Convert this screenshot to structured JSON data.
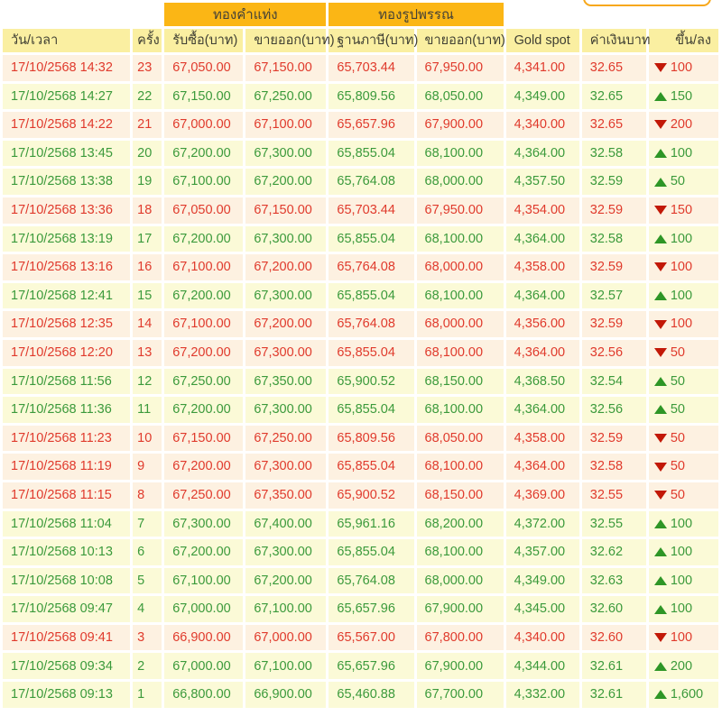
{
  "colors": {
    "page_bg": "#FFFFFF",
    "banner_bg": "#FBB615",
    "banner_text": "#454237",
    "header_bg": "#FAEFA1",
    "header_text": "#3F3F33",
    "up_bg": "#FBFAD7",
    "up_text": "#3B9A3B",
    "down_bg": "#FDF1E1",
    "down_text": "#E03A2C",
    "up_arrow": "#2E9626",
    "down_arrow": "#C21807",
    "button_border": "#F7A81C"
  },
  "table": {
    "group_headers": [
      {
        "label": "ทองคำแท่ง"
      },
      {
        "label": "ทองรูปพรรณ"
      }
    ],
    "columns": [
      "วัน/เวลา",
      "ครั้ง",
      "รับซื้อ(บาท)",
      "ขายออก(บาท)",
      "ฐานภาษี(บาท)",
      "ขายออก(บาท)",
      "Gold spot",
      "ค่าเงินบาท",
      "ขึ้น/ลง"
    ],
    "rows": [
      {
        "datetime": "17/10/2568 14:32",
        "count": "23",
        "bar_buy": "67,050.00",
        "bar_sell": "67,150.00",
        "tax_base": "65,703.44",
        "ornament_sell": "67,950.00",
        "gold_spot": "4,341.00",
        "baht_rate": "32.65",
        "direction": "down",
        "change": "100"
      },
      {
        "datetime": "17/10/2568 14:27",
        "count": "22",
        "bar_buy": "67,150.00",
        "bar_sell": "67,250.00",
        "tax_base": "65,809.56",
        "ornament_sell": "68,050.00",
        "gold_spot": "4,349.00",
        "baht_rate": "32.65",
        "direction": "up",
        "change": "150"
      },
      {
        "datetime": "17/10/2568 14:22",
        "count": "21",
        "bar_buy": "67,000.00",
        "bar_sell": "67,100.00",
        "tax_base": "65,657.96",
        "ornament_sell": "67,900.00",
        "gold_spot": "4,340.00",
        "baht_rate": "32.65",
        "direction": "down",
        "change": "200"
      },
      {
        "datetime": "17/10/2568 13:45",
        "count": "20",
        "bar_buy": "67,200.00",
        "bar_sell": "67,300.00",
        "tax_base": "65,855.04",
        "ornament_sell": "68,100.00",
        "gold_spot": "4,364.00",
        "baht_rate": "32.58",
        "direction": "up",
        "change": "100"
      },
      {
        "datetime": "17/10/2568 13:38",
        "count": "19",
        "bar_buy": "67,100.00",
        "bar_sell": "67,200.00",
        "tax_base": "65,764.08",
        "ornament_sell": "68,000.00",
        "gold_spot": "4,357.50",
        "baht_rate": "32.59",
        "direction": "up",
        "change": "50"
      },
      {
        "datetime": "17/10/2568 13:36",
        "count": "18",
        "bar_buy": "67,050.00",
        "bar_sell": "67,150.00",
        "tax_base": "65,703.44",
        "ornament_sell": "67,950.00",
        "gold_spot": "4,354.00",
        "baht_rate": "32.59",
        "direction": "down",
        "change": "150"
      },
      {
        "datetime": "17/10/2568 13:19",
        "count": "17",
        "bar_buy": "67,200.00",
        "bar_sell": "67,300.00",
        "tax_base": "65,855.04",
        "ornament_sell": "68,100.00",
        "gold_spot": "4,364.00",
        "baht_rate": "32.58",
        "direction": "up",
        "change": "100"
      },
      {
        "datetime": "17/10/2568 13:16",
        "count": "16",
        "bar_buy": "67,100.00",
        "bar_sell": "67,200.00",
        "tax_base": "65,764.08",
        "ornament_sell": "68,000.00",
        "gold_spot": "4,358.00",
        "baht_rate": "32.59",
        "direction": "down",
        "change": "100"
      },
      {
        "datetime": "17/10/2568 12:41",
        "count": "15",
        "bar_buy": "67,200.00",
        "bar_sell": "67,300.00",
        "tax_base": "65,855.04",
        "ornament_sell": "68,100.00",
        "gold_spot": "4,364.00",
        "baht_rate": "32.57",
        "direction": "up",
        "change": "100"
      },
      {
        "datetime": "17/10/2568 12:35",
        "count": "14",
        "bar_buy": "67,100.00",
        "bar_sell": "67,200.00",
        "tax_base": "65,764.08",
        "ornament_sell": "68,000.00",
        "gold_spot": "4,356.00",
        "baht_rate": "32.59",
        "direction": "down",
        "change": "100"
      },
      {
        "datetime": "17/10/2568 12:20",
        "count": "13",
        "bar_buy": "67,200.00",
        "bar_sell": "67,300.00",
        "tax_base": "65,855.04",
        "ornament_sell": "68,100.00",
        "gold_spot": "4,364.00",
        "baht_rate": "32.56",
        "direction": "down",
        "change": "50"
      },
      {
        "datetime": "17/10/2568 11:56",
        "count": "12",
        "bar_buy": "67,250.00",
        "bar_sell": "67,350.00",
        "tax_base": "65,900.52",
        "ornament_sell": "68,150.00",
        "gold_spot": "4,368.50",
        "baht_rate": "32.54",
        "direction": "up",
        "change": "50"
      },
      {
        "datetime": "17/10/2568 11:36",
        "count": "11",
        "bar_buy": "67,200.00",
        "bar_sell": "67,300.00",
        "tax_base": "65,855.04",
        "ornament_sell": "68,100.00",
        "gold_spot": "4,364.00",
        "baht_rate": "32.56",
        "direction": "up",
        "change": "50"
      },
      {
        "datetime": "17/10/2568 11:23",
        "count": "10",
        "bar_buy": "67,150.00",
        "bar_sell": "67,250.00",
        "tax_base": "65,809.56",
        "ornament_sell": "68,050.00",
        "gold_spot": "4,358.00",
        "baht_rate": "32.59",
        "direction": "down",
        "change": "50"
      },
      {
        "datetime": "17/10/2568 11:19",
        "count": "9",
        "bar_buy": "67,200.00",
        "bar_sell": "67,300.00",
        "tax_base": "65,855.04",
        "ornament_sell": "68,100.00",
        "gold_spot": "4,364.00",
        "baht_rate": "32.58",
        "direction": "down",
        "change": "50"
      },
      {
        "datetime": "17/10/2568 11:15",
        "count": "8",
        "bar_buy": "67,250.00",
        "bar_sell": "67,350.00",
        "tax_base": "65,900.52",
        "ornament_sell": "68,150.00",
        "gold_spot": "4,369.00",
        "baht_rate": "32.55",
        "direction": "down",
        "change": "50"
      },
      {
        "datetime": "17/10/2568 11:04",
        "count": "7",
        "bar_buy": "67,300.00",
        "bar_sell": "67,400.00",
        "tax_base": "65,961.16",
        "ornament_sell": "68,200.00",
        "gold_spot": "4,372.00",
        "baht_rate": "32.55",
        "direction": "up",
        "change": "100"
      },
      {
        "datetime": "17/10/2568 10:13",
        "count": "6",
        "bar_buy": "67,200.00",
        "bar_sell": "67,300.00",
        "tax_base": "65,855.04",
        "ornament_sell": "68,100.00",
        "gold_spot": "4,357.00",
        "baht_rate": "32.62",
        "direction": "up",
        "change": "100"
      },
      {
        "datetime": "17/10/2568 10:08",
        "count": "5",
        "bar_buy": "67,100.00",
        "bar_sell": "67,200.00",
        "tax_base": "65,764.08",
        "ornament_sell": "68,000.00",
        "gold_spot": "4,349.00",
        "baht_rate": "32.63",
        "direction": "up",
        "change": "100"
      },
      {
        "datetime": "17/10/2568 09:47",
        "count": "4",
        "bar_buy": "67,000.00",
        "bar_sell": "67,100.00",
        "tax_base": "65,657.96",
        "ornament_sell": "67,900.00",
        "gold_spot": "4,345.00",
        "baht_rate": "32.60",
        "direction": "up",
        "change": "100"
      },
      {
        "datetime": "17/10/2568 09:41",
        "count": "3",
        "bar_buy": "66,900.00",
        "bar_sell": "67,000.00",
        "tax_base": "65,567.00",
        "ornament_sell": "67,800.00",
        "gold_spot": "4,340.00",
        "baht_rate": "32.60",
        "direction": "down",
        "change": "100"
      },
      {
        "datetime": "17/10/2568 09:34",
        "count": "2",
        "bar_buy": "67,000.00",
        "bar_sell": "67,100.00",
        "tax_base": "65,657.96",
        "ornament_sell": "67,900.00",
        "gold_spot": "4,344.00",
        "baht_rate": "32.61",
        "direction": "up",
        "change": "200"
      },
      {
        "datetime": "17/10/2568 09:13",
        "count": "1",
        "bar_buy": "66,800.00",
        "bar_sell": "66,900.00",
        "tax_base": "65,460.88",
        "ornament_sell": "67,700.00",
        "gold_spot": "4,332.00",
        "baht_rate": "32.61",
        "direction": "up",
        "change": "1,600"
      }
    ]
  }
}
